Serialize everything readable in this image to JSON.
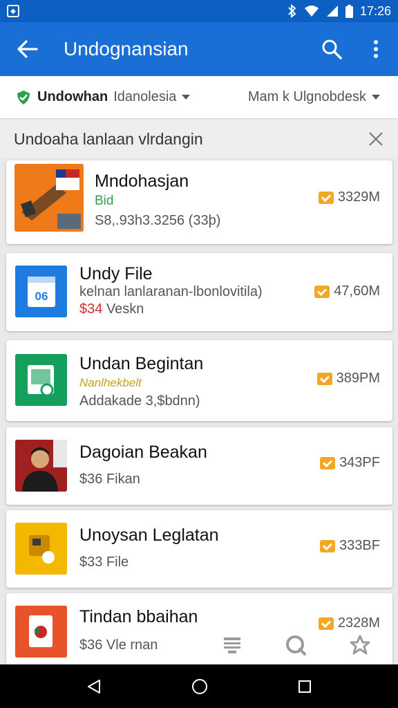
{
  "status_bar": {
    "time": "17:26"
  },
  "app_bar": {
    "title": "Undognansian"
  },
  "filters": {
    "left_strong": "Undowhan",
    "left_light": "Idanolesia",
    "right": "Mam k Ulgnobdesk"
  },
  "section": {
    "title": "Undoaha  lanlaan vlrdangin"
  },
  "items": [
    {
      "name": "Mndohasjan",
      "line1": "Bid",
      "line2": "S8,.93h3.3256 (33þ)",
      "size": "3329M"
    },
    {
      "name": "Undy File",
      "line1": "kelnan lanlaranan-lbonlovitila)",
      "line2_price": "$34",
      "line2": "Veskn",
      "size": "47,60M"
    },
    {
      "name": "Undan Begintan",
      "line1": "Nanlhekbelt",
      "line2": "Addakade 3,$bdnn)",
      "size": "389PM"
    },
    {
      "name": "Dagoian Beakan",
      "line2": "$36 Fikan",
      "size": "343PF"
    },
    {
      "name": "Unoysan Leglatan",
      "line2": "$33 File",
      "size": "333BF"
    },
    {
      "name": "Tindan bbaihan",
      "line2": "$36 Vle rnan",
      "size": "2328M"
    }
  ],
  "colors": {
    "primary": "#1a6fd6",
    "status": "#0d5fc2",
    "accent_size": "#f5a623",
    "green": "#2e9e4a",
    "red": "#d32f2f",
    "gold": "#c7a21a"
  }
}
